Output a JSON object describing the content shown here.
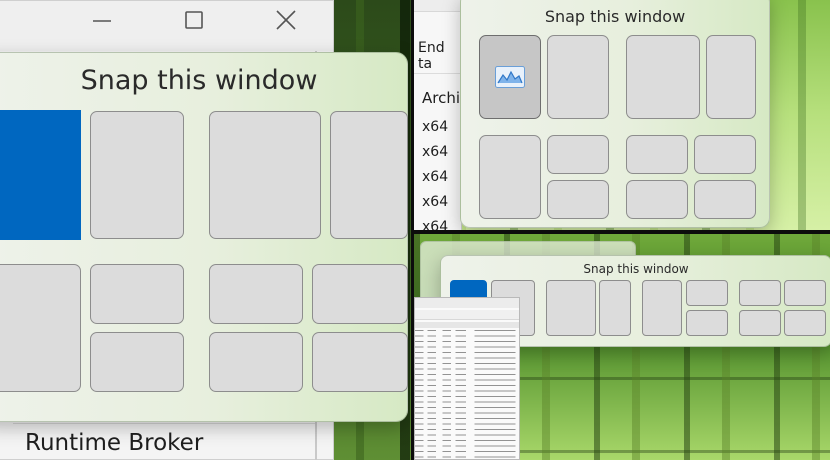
{
  "left_panel": {
    "flyout_title": "Snap this window",
    "bottom_process": "Runtime Broker",
    "caption": {
      "minimize_icon": "minimize-icon",
      "maximize_icon": "maximize-icon",
      "close_icon": "close-icon"
    }
  },
  "top_right_panel": {
    "flyout_title": "Snap this window",
    "end_task_partial": "End ta",
    "column_header_partial": "Archi",
    "rows": [
      "x64",
      "x64",
      "x64",
      "x64",
      "x64"
    ]
  },
  "bottom_right_panel": {
    "flyout_title": "Snap this window"
  },
  "colors": {
    "selected_zone": "#0067c0",
    "zone_fill": "#dcdcdc",
    "zone_border": "#8d8d8d"
  }
}
